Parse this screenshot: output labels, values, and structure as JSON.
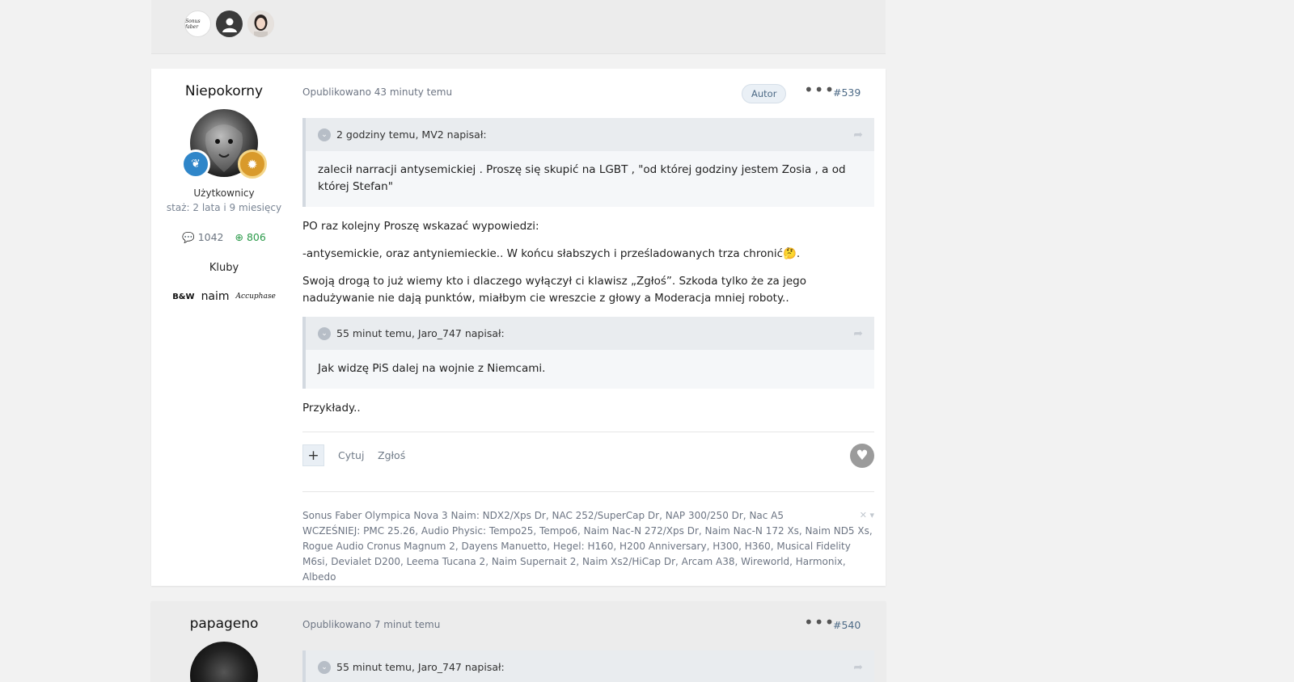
{
  "previous_post": {
    "avatars": [
      {
        "name": "sonus-faber-club",
        "text": "Sonus faber"
      },
      {
        "name": "user-avatar"
      },
      {
        "name": "woman-avatar"
      }
    ]
  },
  "post1": {
    "author": {
      "name": "Niepokorny",
      "group": "Użytkownicy",
      "since": "staż: 2 lata i 9 miesięcy",
      "comments": "1042",
      "reputation": "806",
      "clubs_label": "Kluby",
      "clubs": [
        "B&W",
        "naim",
        "Accuphase"
      ]
    },
    "meta": "Opublikowano 43 minuty temu",
    "badge": "Autor",
    "more": "•••",
    "number": "#539",
    "quote1": {
      "header": "2 godziny temu, MV2 napisał:",
      "body": "zalecił narracji antysemickiej . Proszę się skupić na LGBT , \"od której godziny jestem Zosia , a od której Stefan\""
    },
    "paragraphs": [
      "PO raz kolejny Proszę wskazać wypowiedzi:",
      "-antysemickie, oraz antyniemieckie.. W końcu słabszych i prześladowanych trza chronić🤔.",
      "Swoją drogą to już wiemy kto i dlaczego wyłączył ci klawisz „Zgłoś”. Szkoda tylko że za jego nadużywanie nie dają punktów, miałbym cie wreszcie z głowy a Moderacja mniej roboty.."
    ],
    "quote2": {
      "header": "55 minut temu, Jaro_747 napisał:",
      "body": "Jak widzę PiS dalej na wojnie z Niemcami."
    },
    "closing": "Przykłady..",
    "actions": {
      "plus": "+",
      "quote": "Cytuj",
      "report": "Zgłoś"
    },
    "signature": "Sonus Faber Olympica Nova 3            Naim: NDX2/Xps Dr, NAC 252/SuperCap Dr, NAP 300/250 Dr, Nac A5\n WCZEŚNIEJ: PMC 25.26, Audio Physic: Tempo25, Tempo6, Naim Nac-N 272/Xps Dr, Naim Nac-N 172 Xs, Naim ND5 Xs, Rogue Audio Cronus Magnum 2, Dayens Manuetto, Hegel: H160, H200 Anniversary, H300, H360, Musical Fidelity M6si, Devialet D200, Leema Tucana 2, Naim Supernait 2, Naim Xs2/HiCap Dr, Arcam A38, Wireworld, Harmonix, Albedo"
  },
  "post2": {
    "author": {
      "name": "papageno"
    },
    "meta": "Opublikowano 7 minut temu",
    "more": "•••",
    "number": "#540",
    "quote1": {
      "header": "55 minut temu, Jaro_747 napisał:"
    }
  }
}
